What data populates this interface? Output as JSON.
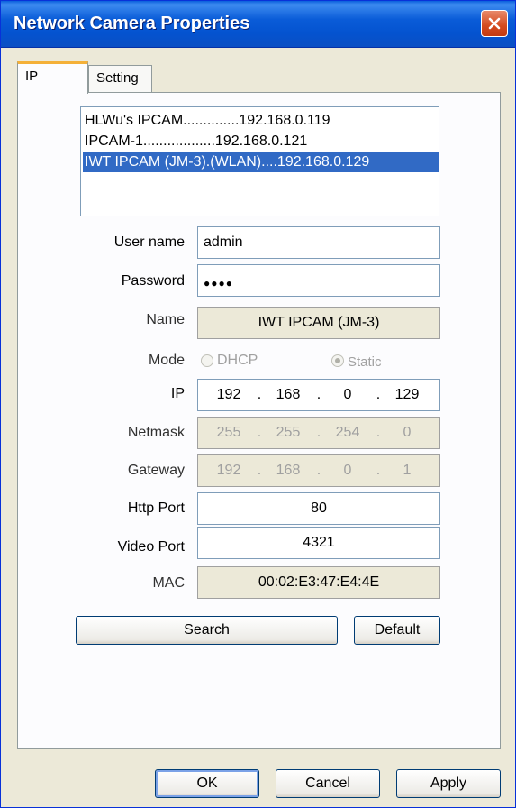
{
  "window": {
    "title": "Network Camera Properties"
  },
  "tabs": [
    {
      "label": "IP"
    },
    {
      "label": "Setting"
    }
  ],
  "camera_list": [
    {
      "label": "HLWu's IPCAM..............192.168.0.119",
      "selected": false
    },
    {
      "label": "IPCAM-1..................192.168.0.121",
      "selected": false
    },
    {
      "label": "IWT IPCAM (JM-3).(WLAN)....192.168.0.129",
      "selected": true
    }
  ],
  "form": {
    "user_name_label": "User name",
    "user_name_value": "admin",
    "password_label": "Password",
    "password_value": "●●●●",
    "name_label": "Name",
    "name_value": "IWT IPCAM (JM-3)",
    "mode_label": "Mode",
    "mode_dhcp_label": "DHCP",
    "mode_static_label": "Static",
    "mode_selected": "Static",
    "ip_label": "IP",
    "ip": [
      "192",
      "168",
      "0",
      "129"
    ],
    "netmask_label": "Netmask",
    "netmask": [
      "255",
      "255",
      "254",
      "0"
    ],
    "gateway_label": "Gateway",
    "gateway": [
      "192",
      "168",
      "0",
      "1"
    ],
    "http_port_label": "Http Port",
    "http_port_value": "80",
    "video_port_label": "Video Port",
    "video_port_value": "4321",
    "mac_label": "MAC",
    "mac_value": "00:02:E3:47:E4:4E",
    "ip_separator": "."
  },
  "buttons": {
    "search": "Search",
    "default": "Default",
    "ok": "OK",
    "cancel": "Cancel",
    "apply": "Apply"
  }
}
